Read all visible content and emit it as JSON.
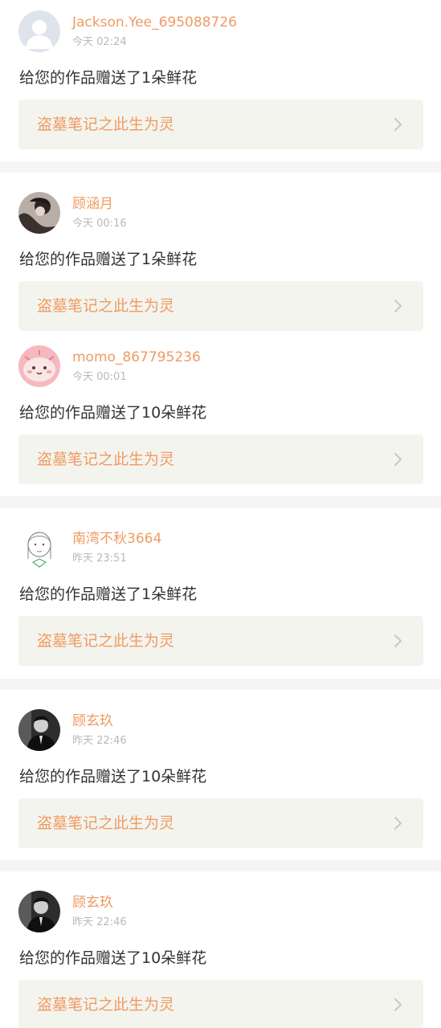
{
  "theme": {
    "accent": "#ef9b62",
    "link_bg": "#f4f4ee",
    "chevron": "#c8c8c8"
  },
  "notifications": [
    {
      "username": "Jackson.Yee_695088726",
      "time": "今天 02:24",
      "message": "给您的作品赠送了1朵鲜花",
      "work_title": "盗墓笔记之此生为灵",
      "avatar_icon": "default-user-avatar"
    },
    {
      "username": "顾涵月",
      "time": "今天 00:16",
      "message": "给您的作品赠送了1朵鲜花",
      "work_title": "盗墓笔记之此生为灵",
      "avatar_icon": "photo-avatar"
    },
    {
      "username": "momo_867795236",
      "time": "今天 00:01",
      "message": "给您的作品赠送了10朵鲜花",
      "work_title": "盗墓笔记之此生为灵",
      "avatar_icon": "pink-cartoon-avatar"
    },
    {
      "username": "南湾不秋3664",
      "time": "昨天 23:51",
      "message": "给您的作品赠送了1朵鲜花",
      "work_title": "盗墓笔记之此生为灵",
      "avatar_icon": "sketch-girl-avatar"
    },
    {
      "username": "顾玄玖",
      "time": "昨天 22:46",
      "message": "给您的作品赠送了10朵鲜花",
      "work_title": "盗墓笔记之此生为灵",
      "avatar_icon": "dark-photo-avatar"
    },
    {
      "username": "顾玄玖",
      "time": "昨天 22:46",
      "message": "给您的作品赠送了10朵鲜花",
      "work_title": "盗墓笔记之此生为灵",
      "avatar_icon": "dark-photo-avatar"
    }
  ]
}
